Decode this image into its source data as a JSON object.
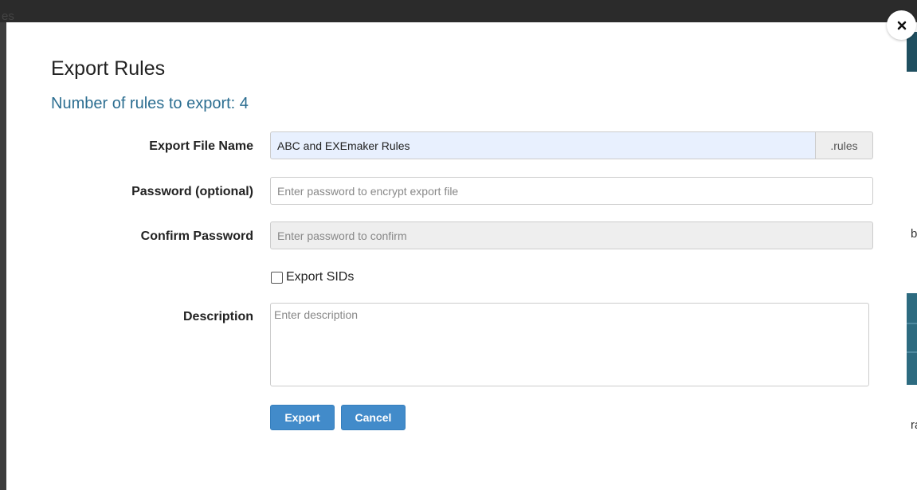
{
  "modal": {
    "title": "Export Rules",
    "subtitle": "Number of rules to export: 4",
    "close_icon": "close-icon"
  },
  "form": {
    "file_name": {
      "label": "Export File Name",
      "value": "ABC and EXEmaker Rules",
      "suffix": ".rules"
    },
    "password": {
      "label": "Password (optional)",
      "placeholder": "Enter password to encrypt export file"
    },
    "confirm_password": {
      "label": "Confirm Password",
      "placeholder": "Enter password to confirm"
    },
    "export_sids": {
      "label": "Export SIDs",
      "checked": false
    },
    "description": {
      "label": "Description",
      "placeholder": "Enter description"
    }
  },
  "buttons": {
    "export": "Export",
    "cancel": "Cancel"
  },
  "background": {
    "fragments": [
      "es",
      "bl",
      "ra"
    ]
  },
  "colors": {
    "subtitle": "#2c6e91",
    "button": "#428bca",
    "filename_bg": "#e8f0fe"
  }
}
